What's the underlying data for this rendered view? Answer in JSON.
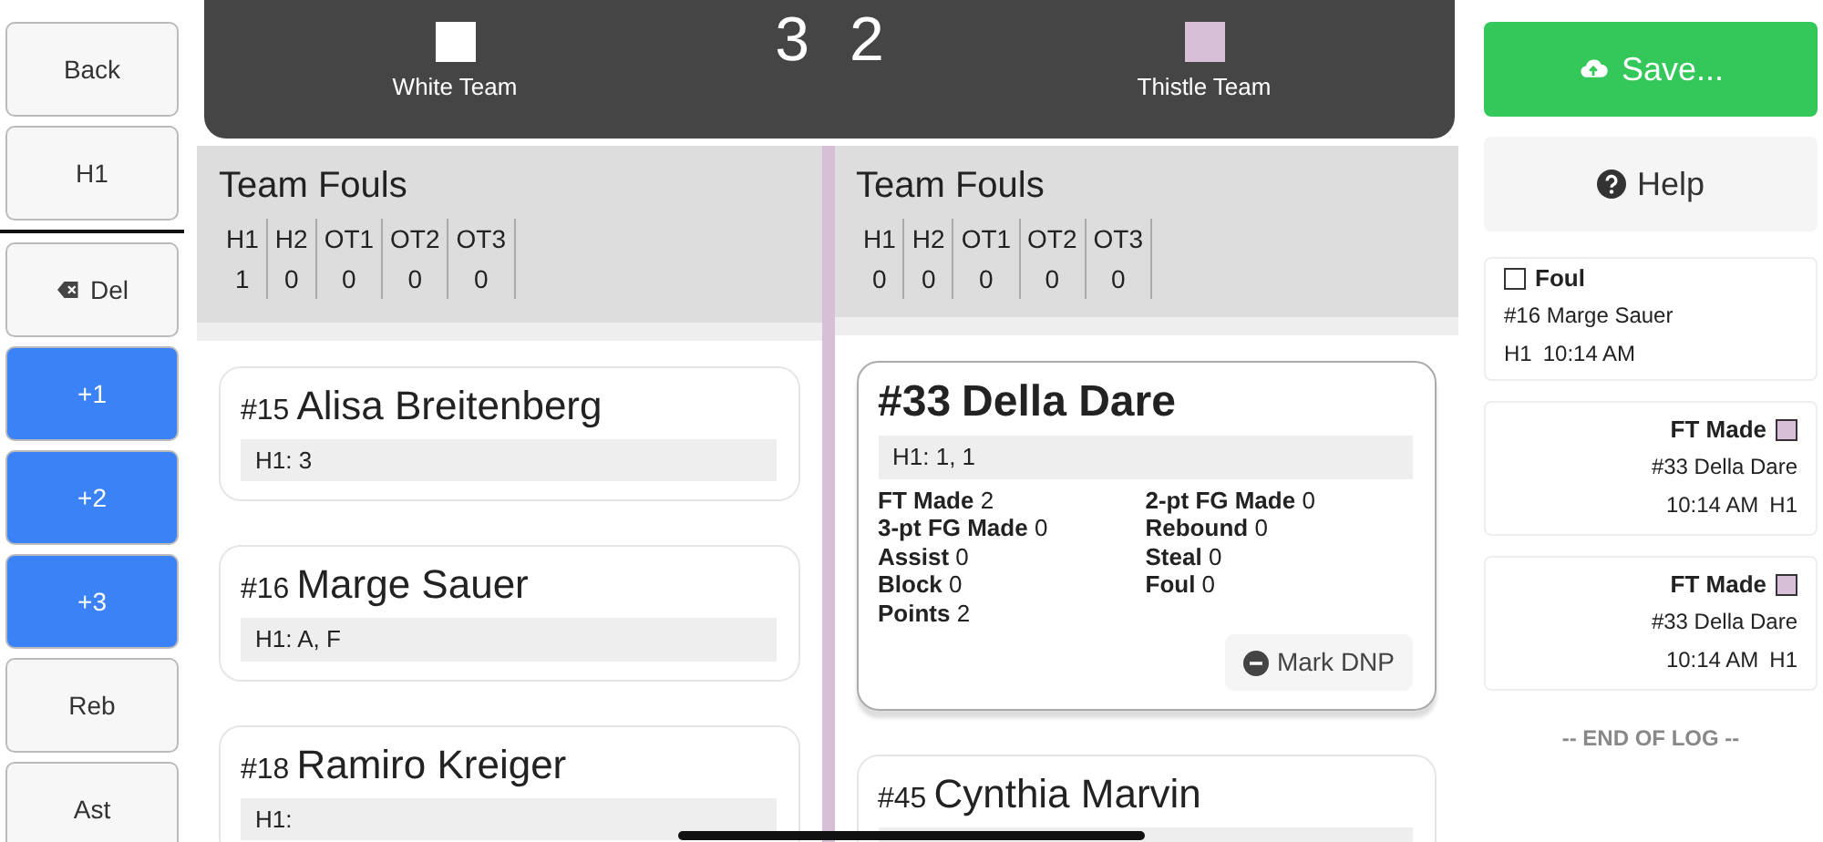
{
  "nav_buttons": [
    {
      "label": "Back"
    },
    {
      "label": "H1"
    }
  ],
  "action_buttons": [
    {
      "label": "Del",
      "kind": "delete"
    },
    {
      "label": "+1",
      "kind": "score"
    },
    {
      "label": "+2",
      "kind": "score"
    },
    {
      "label": "+3",
      "kind": "score"
    },
    {
      "label": "Reb",
      "kind": "plain"
    },
    {
      "label": "Ast",
      "kind": "plain"
    }
  ],
  "scoreboard": {
    "teams": [
      {
        "name": "White Team",
        "color": "#ffffff"
      },
      {
        "name": "Thistle Team",
        "color": "#d8bfd8"
      }
    ],
    "scores": [
      "3",
      "2"
    ]
  },
  "teams": [
    {
      "fouls": {
        "title": "Team Fouls",
        "headers": [
          "H1",
          "H2",
          "OT1",
          "OT2",
          "OT3"
        ],
        "values": [
          "1",
          "0",
          "0",
          "0",
          "0"
        ]
      },
      "players": [
        {
          "number": "#15",
          "name": "Alisa Breitenberg",
          "periods": "H1: 3",
          "selected": false
        },
        {
          "number": "#16",
          "name": "Marge Sauer",
          "periods": "H1: A, F",
          "selected": false
        },
        {
          "number": "#18",
          "name": "Ramiro Kreiger",
          "periods": "H1:",
          "selected": false
        }
      ]
    },
    {
      "fouls": {
        "title": "Team Fouls",
        "headers": [
          "H1",
          "H2",
          "OT1",
          "OT2",
          "OT3"
        ],
        "values": [
          "0",
          "0",
          "0",
          "0",
          "0"
        ]
      },
      "players": [
        {
          "number": "#33",
          "name": "Della Dare",
          "periods": "H1: 1, 1",
          "selected": true,
          "stats": [
            {
              "label": "FT Made",
              "value": "2"
            },
            {
              "label": "2-pt FG Made",
              "value": "0"
            },
            {
              "label": "3-pt FG Made",
              "value": "0"
            },
            {
              "label": "Rebound",
              "value": "0"
            },
            {
              "label": "Assist",
              "value": "0"
            },
            {
              "label": "Steal",
              "value": "0"
            },
            {
              "label": "Block",
              "value": "0"
            },
            {
              "label": "Foul",
              "value": "0"
            },
            {
              "label": "Points",
              "value": "2"
            }
          ],
          "dnp_button": "Mark DNP"
        },
        {
          "number": "#45",
          "name": "Cynthia Marvin",
          "selected": false
        }
      ]
    }
  ],
  "save_button": "Save...",
  "help_button": "Help",
  "log": {
    "entries": [
      {
        "kind": "home",
        "event": "Foul",
        "player": "#16 Marge Sauer",
        "period": "H1",
        "time": "10:14 AM",
        "color": "#ffffff"
      },
      {
        "kind": "away",
        "event": "FT Made",
        "player": "#33 Della Dare",
        "period": "H1",
        "time": "10:14 AM",
        "color": "#d8bfd8"
      },
      {
        "kind": "away",
        "event": "FT Made",
        "player": "#33 Della Dare",
        "period": "H1",
        "time": "10:14 AM",
        "color": "#d8bfd8"
      }
    ],
    "end_text": "-- END OF LOG --"
  }
}
